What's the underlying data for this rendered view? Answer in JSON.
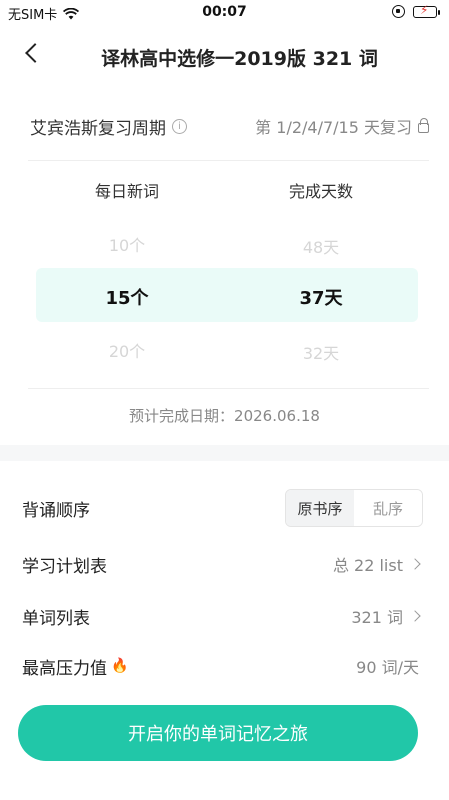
{
  "status_bar": {
    "carrier": "无SIM卡",
    "time": "00:07"
  },
  "nav": {
    "title": "译林高中选修一2019版 321 词"
  },
  "review_cycle": {
    "label": "艾宾浩斯复习周期",
    "value": "第 1/2/4/7/15 天复习"
  },
  "picker": {
    "daily_header": "每日新词",
    "days_header": "完成天数",
    "daily_options": [
      "10个",
      "15个",
      "20个"
    ],
    "days_options": [
      "48天",
      "37天",
      "32天"
    ]
  },
  "estimate": {
    "text": "预计完成日期：2026.06.18"
  },
  "order": {
    "label": "背诵顺序",
    "options": [
      "原书序",
      "乱序"
    ],
    "selected": "原书序"
  },
  "plan": {
    "label": "学习计划表",
    "value": "总 22 list"
  },
  "word_list": {
    "label": "单词列表",
    "value": "321 词"
  },
  "pressure": {
    "label": "最高压力值",
    "value": "90 词/天"
  },
  "cta": {
    "label": "开启你的单词记忆之旅"
  },
  "colors": {
    "accent": "#21c7a8",
    "highlight": "#eafbf8"
  }
}
